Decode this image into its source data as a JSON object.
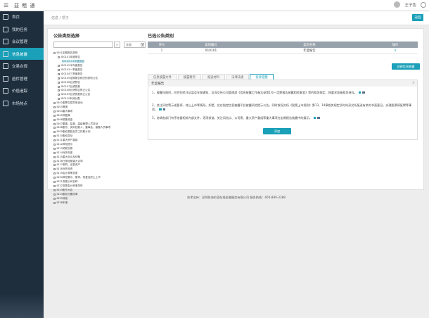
{
  "topbar": {
    "menu_icon": "menu-icon",
    "title": "益 租 通",
    "user": "王子色"
  },
  "sidebar": {
    "items": [
      {
        "label": "首页",
        "icon": "home-icon"
      },
      {
        "label": "我的任务",
        "icon": "task-icon"
      },
      {
        "label": "会议管理",
        "icon": "meeting-icon"
      },
      {
        "label": "信息披露",
        "icon": "disclosure-icon"
      },
      {
        "label": "交易合规",
        "icon": "trade-icon"
      },
      {
        "label": "函件管理",
        "icon": "letter-icon"
      },
      {
        "label": "价值追踪",
        "icon": "value-icon"
      },
      {
        "label": "市场热点",
        "icon": "hot-icon"
      }
    ],
    "active_index": 3
  },
  "crumb": "信息 / 项子",
  "back_label": "返回",
  "left": {
    "title": "公告类别选择",
    "select_value": "全部",
    "tree": [
      {
        "label": "ID01定期报告类别",
        "level": 0,
        "toggle": "-"
      },
      {
        "label": "ID0101年度报告",
        "level": 1,
        "toggle": "-"
      },
      {
        "label": "ID010101年度报告",
        "level": 2,
        "toggle": "",
        "selected": true
      },
      {
        "label": "ID0102半年度报告",
        "level": 1,
        "toggle": "+"
      },
      {
        "label": "ID0103一季度报告",
        "level": 1,
        "toggle": "+"
      },
      {
        "label": "ID0104三季度报告",
        "level": 1,
        "toggle": "+"
      },
      {
        "label": "ID0105定期报告相关的其他公告",
        "level": 1,
        "toggle": "+"
      },
      {
        "label": "ID0106业绩预告",
        "level": 1,
        "toggle": "+"
      },
      {
        "label": "ID0107业绩快报",
        "level": 1,
        "toggle": "+"
      },
      {
        "label": "ID0108业绩预告修正公告",
        "level": 1,
        "toggle": "+"
      },
      {
        "label": "ID0109业绩快报修正公告",
        "level": 1,
        "toggle": "+"
      },
      {
        "label": "ID0110利润分配",
        "level": 1,
        "toggle": "+"
      },
      {
        "label": "ID02股票交易异常波动",
        "level": 0,
        "toggle": "+"
      },
      {
        "label": "ID03澄清",
        "level": 0,
        "toggle": "+"
      },
      {
        "label": "ID04重大事项",
        "level": 0,
        "toggle": "+"
      },
      {
        "label": "ID05停复牌",
        "level": 0,
        "toggle": "+"
      },
      {
        "label": "ID06募集资金",
        "level": 0,
        "toggle": "+"
      },
      {
        "label": "ID07董事、监事、高级管理人员变动",
        "level": 0,
        "toggle": "+"
      },
      {
        "label": "ID08股东、实际控制人、董事会、高管人员事项",
        "level": 0,
        "toggle": "+"
      },
      {
        "label": "ID09股权激励及员工持股计划",
        "level": 0,
        "toggle": "+"
      },
      {
        "label": "ID10股权变动",
        "level": 0,
        "toggle": "+"
      },
      {
        "label": "ID11重大资产重组",
        "level": 0,
        "toggle": "+"
      },
      {
        "label": "ID12风险提示",
        "level": 0,
        "toggle": "+"
      },
      {
        "label": "ID13关联交易",
        "level": 0,
        "toggle": "+"
      },
      {
        "label": "ID14对外担保",
        "level": 0,
        "toggle": "+"
      },
      {
        "label": "ID15重大诉讼及仲裁",
        "level": 0,
        "toggle": "+"
      },
      {
        "label": "ID16日常经营重大合同",
        "level": 0,
        "toggle": "+"
      },
      {
        "label": "ID17收购、出售资产",
        "level": 0,
        "toggle": "+"
      },
      {
        "label": "ID18对外投资",
        "level": 0,
        "toggle": "+"
      },
      {
        "label": "ID19会计政策变更",
        "level": 0,
        "toggle": "+"
      },
      {
        "label": "ID20风险警示、暂停、恢复及终止上市",
        "level": 0,
        "toggle": "+"
      },
      {
        "label": "ID21变更公司名称",
        "level": 0,
        "toggle": "+"
      },
      {
        "label": "ID22变更会计师事务所",
        "level": 0,
        "toggle": "+"
      },
      {
        "label": "ID23股东大会",
        "level": 0,
        "toggle": "+"
      },
      {
        "label": "ID24股权分置改革",
        "level": 0,
        "toggle": "+"
      },
      {
        "label": "ID25其他",
        "level": 0,
        "toggle": "+"
      },
      {
        "label": "ID26年报",
        "level": 0,
        "toggle": "+"
      }
    ]
  },
  "right": {
    "title": "已选公告类别",
    "table": {
      "headers": [
        "序号",
        "类别编号",
        "类别名称",
        "操作"
      ],
      "rows": [
        [
          "1",
          "010101",
          "年度报告",
          "✕"
        ]
      ]
    },
    "add_button": "创建信息披露",
    "tabs": [
      "信息披露文件",
      "披露要点",
      "报送材料",
      "法律法规",
      "投诉提醒"
    ],
    "active_tab": 4,
    "dialog": {
      "title": "年度报告",
      "items": [
        "1、披露年报时，应特别关注证监会年报通知、及深交所公司管理部《信息披露工作备忘录第1号—定期报告披露相关事宜》等的相关规定，按要求准备相关材料。",
        "2、关注风险警示或暂停、终止上市等情形。如是，应在指定信息披露平台披露风险提示公告，同时按深交所《股票上市规则》第13、14章相关规定及时向深交所报送有关的书面意见，办理股票停复牌等事项。",
        "3、协调各部门有序准备相关内部文件，逐项核准，关注风险点、公司债、重大资产重组等重大事项在定期报告披露中的展示。"
      ],
      "add_label": "添加"
    }
  },
  "footer": "技术支持：深圳前海价值在线金融服务有限公司   服务热线：400-880-3388",
  "colors": {
    "accent": "#1aa0b8",
    "sidebar": "#1e2e3d",
    "table_head": "#97a1ab"
  }
}
